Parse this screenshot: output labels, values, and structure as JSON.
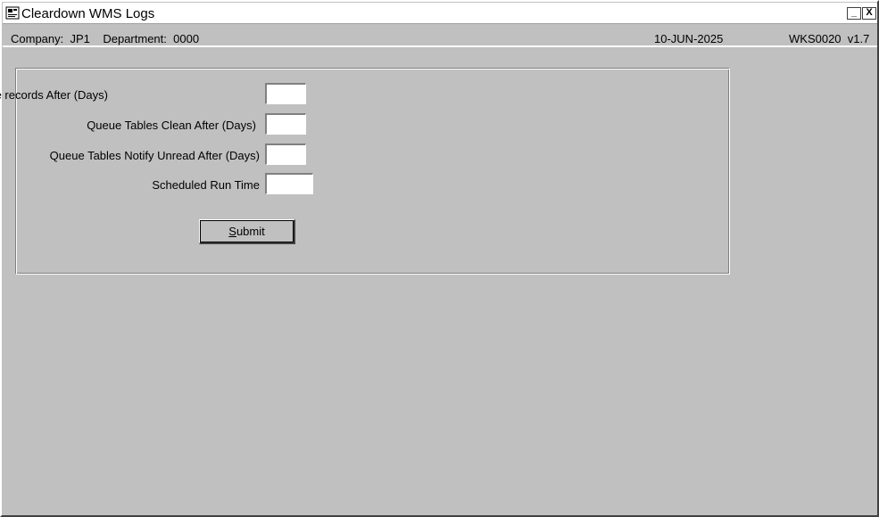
{
  "window": {
    "title": "Cleardown WMS Logs",
    "minimize_glyph": "_",
    "close_glyph": "X"
  },
  "infobar": {
    "company_label": "Company:",
    "company_value": "JP1",
    "department_label": "Department:",
    "department_value": "0000",
    "date": "10-JUN-2025",
    "screen_code": "WKS0020",
    "version": "v1.7"
  },
  "form": {
    "fields": [
      {
        "label": "Remove records After (Days)",
        "value": ""
      },
      {
        "label": "Queue Tables Clean After (Days)",
        "value": ""
      },
      {
        "label": "Queue Tables Notify Unread After (Days)",
        "value": ""
      },
      {
        "label": "Scheduled Run Time",
        "value": ""
      }
    ],
    "submit_mnemonic": "S",
    "submit_rest": "ubmit"
  },
  "icons": {
    "app": "form-app-icon",
    "minimize": "minimize-icon",
    "close": "close-icon"
  },
  "colors": {
    "background": "#c0c0c0",
    "titlebar": "#ffffff",
    "input": "#ffffff"
  }
}
